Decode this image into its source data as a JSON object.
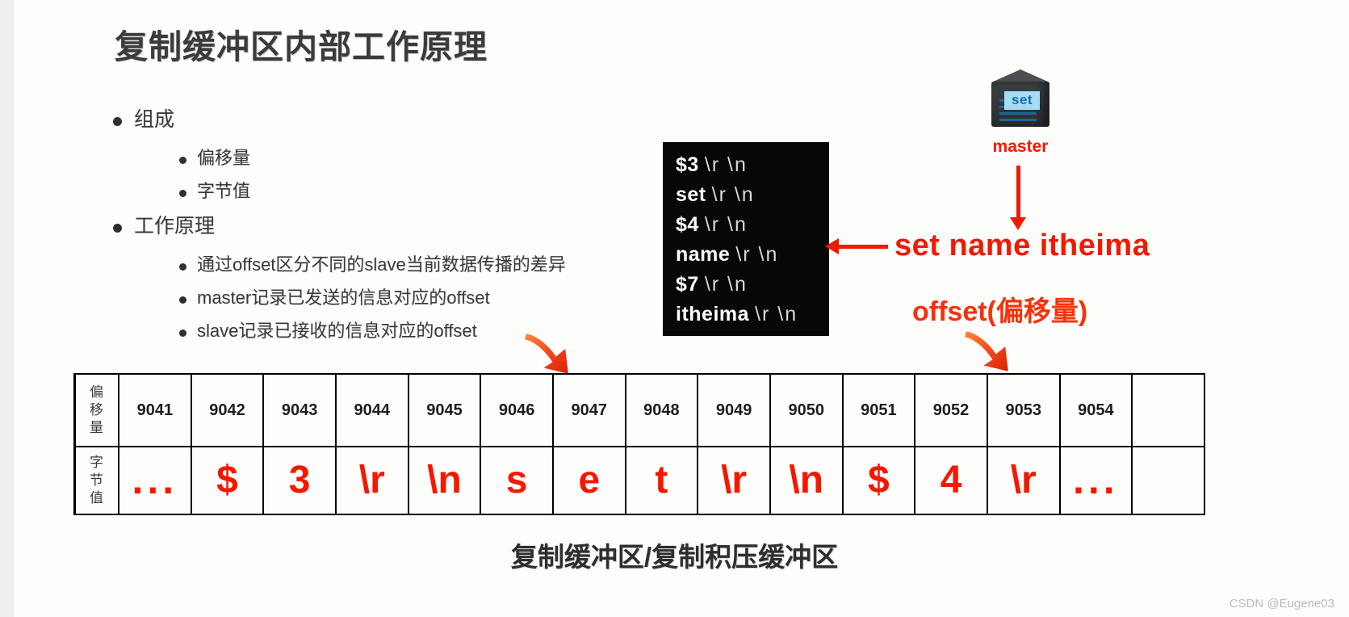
{
  "slide": {
    "title": "复制缓冲区内部工作原理",
    "caption": "复制缓冲区/复制积压缓冲区",
    "watermark": "CSDN @Eugene03"
  },
  "bullets": [
    {
      "level": 1,
      "text": "组成"
    },
    {
      "level": 2,
      "text": "偏移量"
    },
    {
      "level": 2,
      "text": "字节值"
    },
    {
      "level": 1,
      "text": "工作原理"
    },
    {
      "level": 2,
      "text": "通过offset区分不同的slave当前数据传播的差异"
    },
    {
      "level": 2,
      "text": "master记录已发送的信息对应的offset"
    },
    {
      "level": 2,
      "text": "slave记录已接收的信息对应的offset"
    }
  ],
  "resp_box": {
    "lines": [
      {
        "token": "$3",
        "crlf": "\\r \\n"
      },
      {
        "token": "set",
        "crlf": "\\r \\n"
      },
      {
        "token": "$4",
        "crlf": "\\r \\n"
      },
      {
        "token": "name",
        "crlf": "\\r \\n"
      },
      {
        "token": "$7",
        "crlf": "\\r \\n"
      },
      {
        "token": "itheima",
        "crlf": "\\r \\n"
      }
    ]
  },
  "server": {
    "badge": "set",
    "label": "master"
  },
  "annotations": {
    "command": "set name itheima",
    "offset": "offset(偏移量)"
  },
  "table": {
    "row_labels": {
      "offset": "偏移量",
      "byte": "字节值"
    },
    "offsets": [
      "9041",
      "9042",
      "9043",
      "9044",
      "9045",
      "9046",
      "9047",
      "9048",
      "9049",
      "9050",
      "9051",
      "9052",
      "9053",
      "9054",
      ""
    ],
    "bytes": [
      "...",
      "$",
      "3",
      "\\r",
      "\\n",
      "s",
      "e",
      "t",
      "\\r",
      "\\n",
      "$",
      "4",
      "\\r",
      "...",
      ""
    ]
  },
  "colors": {
    "red": "#f41800",
    "badge_bg": "#a6ddf5",
    "badge_text": "#1468b5",
    "box_bg": "#070707"
  }
}
